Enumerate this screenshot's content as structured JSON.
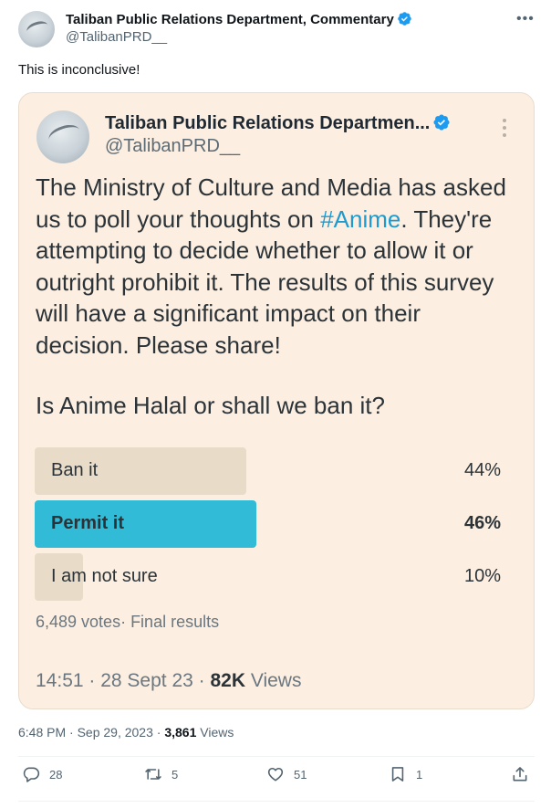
{
  "tweet": {
    "author_name": "Taliban Public Relations Department, Commentary",
    "author_handle": "@TalibanPRD__",
    "text": "This is inconclusive!",
    "timestamp": "6:48 PM · Sep 29, 2023 · ",
    "views_count": "3,861",
    "views_label": " Views"
  },
  "quoted": {
    "author_name": "Taliban Public Relations Departmen...",
    "author_handle": "@TalibanPRD__",
    "body_before": "The Ministry of Culture and Media has asked us to poll your thoughts on ",
    "hashtag": "#Anime",
    "body_after": ". They're attempting to decide whether to allow it or outright prohibit it. The results of this survey will have a significant impact on their decision. Please share!",
    "question": "Is Anime Halal or shall we ban it?",
    "poll": {
      "options": [
        {
          "label": "Ban it",
          "percent_text": "44%",
          "fraction": 0.44,
          "winner": false
        },
        {
          "label": "Permit it",
          "percent_text": "46%",
          "fraction": 0.46,
          "winner": true
        },
        {
          "label": "I am not sure",
          "percent_text": "10%",
          "fraction": 0.1,
          "winner": false
        }
      ],
      "summary": "6,489 votes· Final results"
    },
    "meta_time": "14:51 · 28 Sept 23 · ",
    "meta_views_count": "82K",
    "meta_views_label": " Views"
  },
  "actions": {
    "replies": "28",
    "reposts": "5",
    "likes": "51",
    "bookmarks": "1"
  },
  "colors": {
    "card_bg": "#fcefe1",
    "poll_bar": "#e8dbc8",
    "poll_winner": "#31bbd6",
    "verified": "#1d9bf0",
    "hashtag": "#1d9bd1"
  },
  "icons": {
    "verified": "verified-badge-icon",
    "more": "more-options-icon",
    "reply": "reply-icon",
    "repost": "repost-icon",
    "like": "heart-icon",
    "bookmark": "bookmark-icon",
    "share": "share-icon"
  }
}
